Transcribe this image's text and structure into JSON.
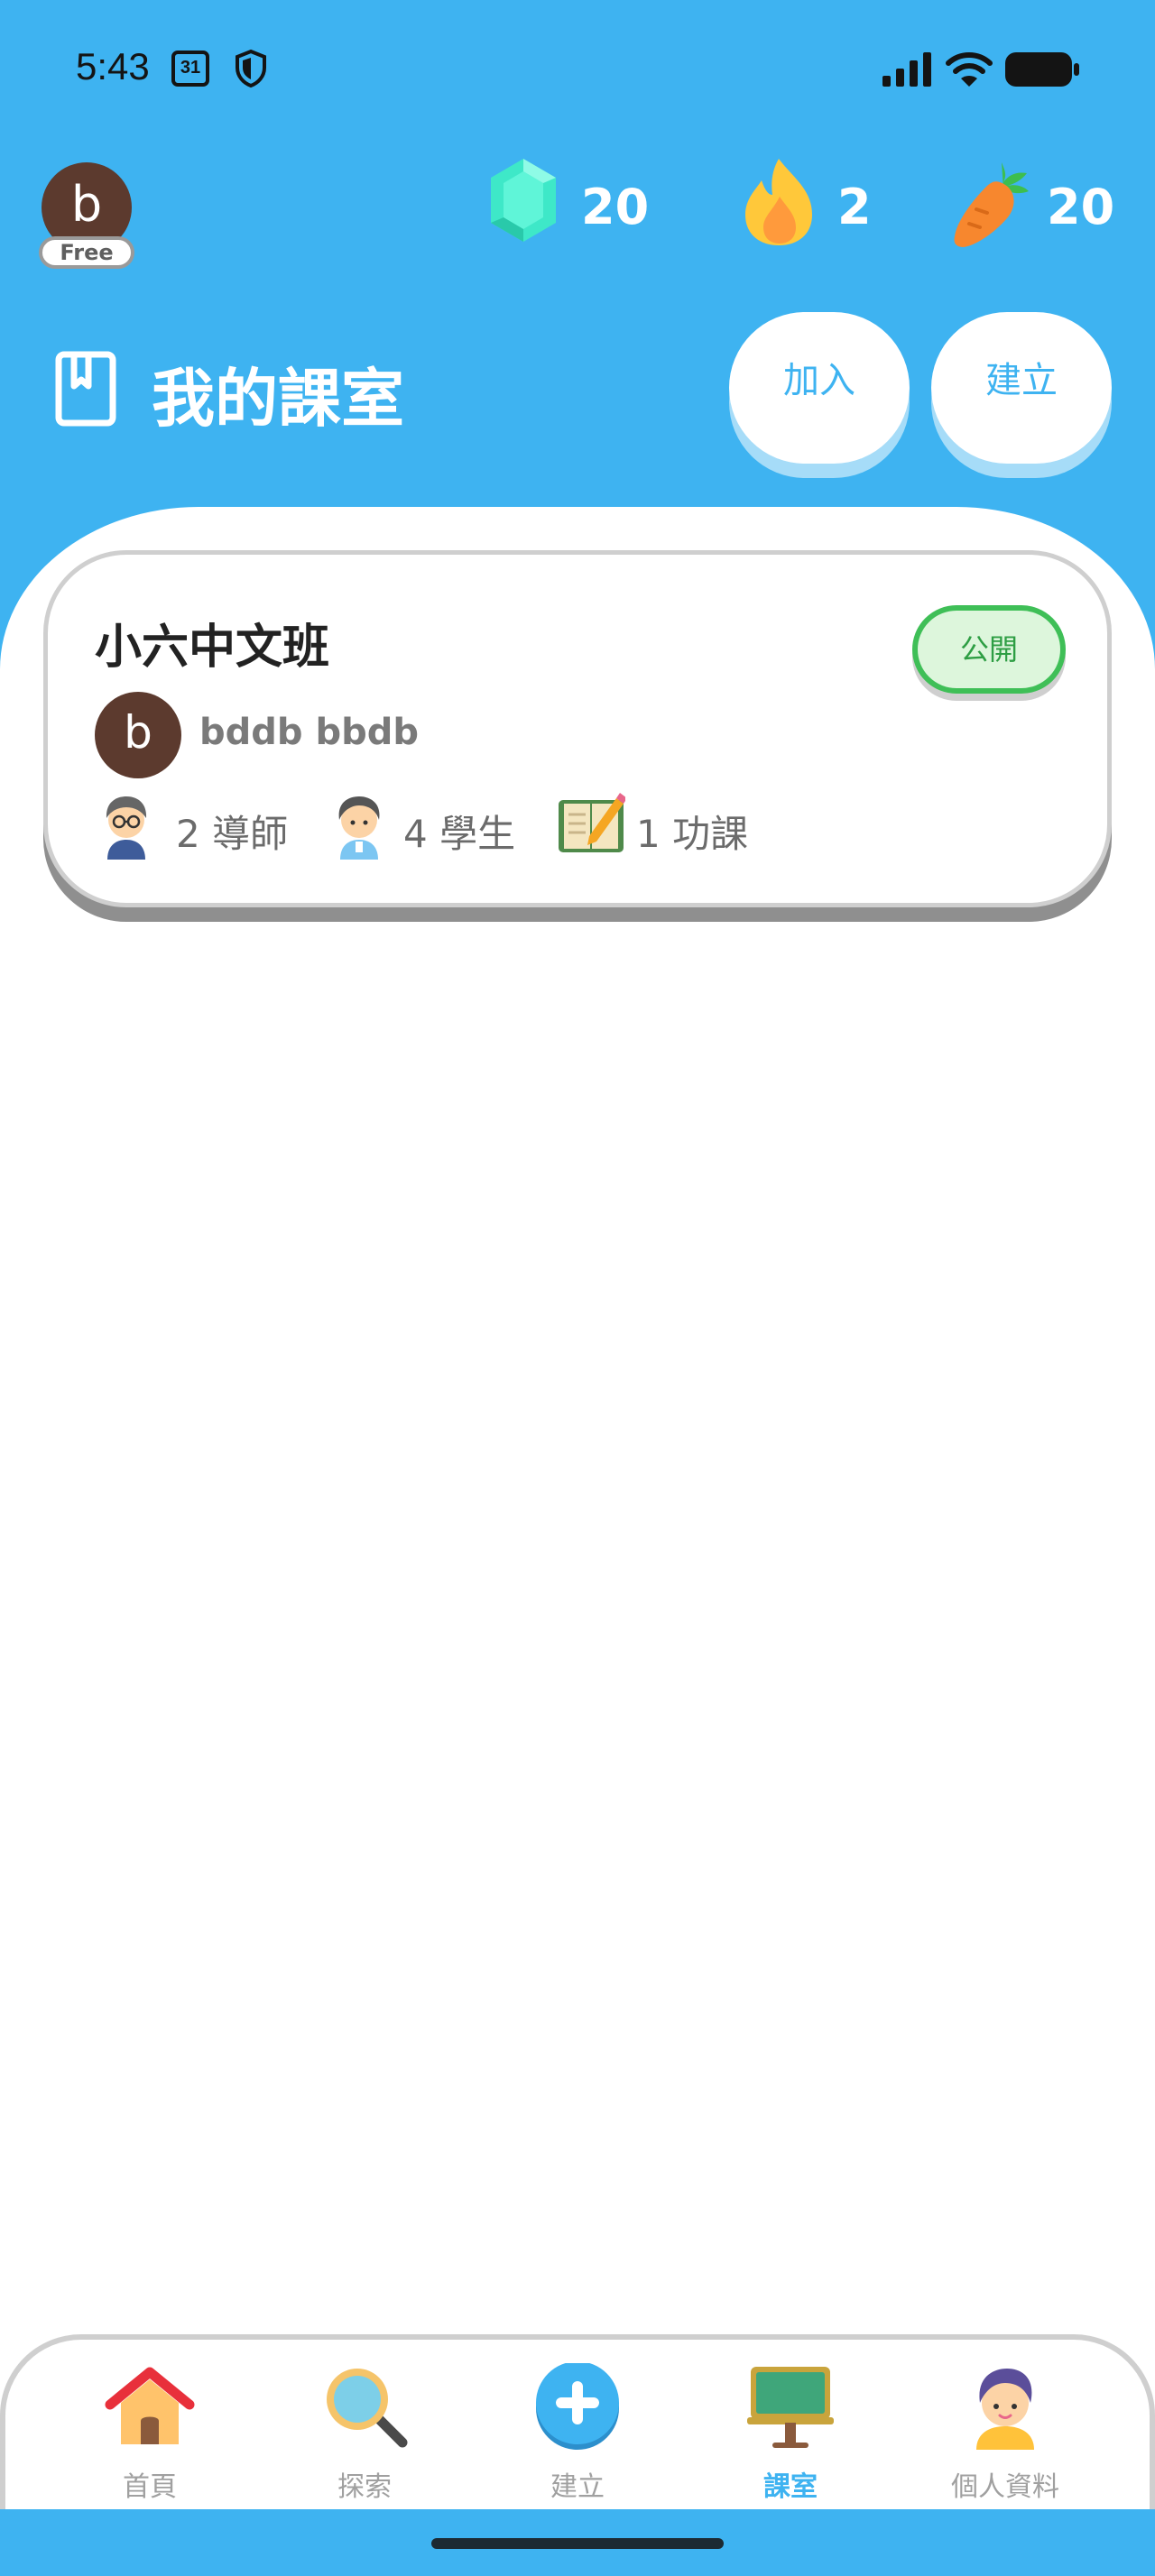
{
  "status_bar": {
    "time": "5:43",
    "calendar_day": "31"
  },
  "header": {
    "avatar_letter": "b",
    "plan_badge": "Free",
    "stats": [
      {
        "icon": "gem-icon",
        "value": "20"
      },
      {
        "icon": "flame-icon",
        "value": "2"
      },
      {
        "icon": "carrot-icon",
        "value": "20"
      }
    ],
    "title": "我的課室",
    "join_label": "加入",
    "create_label": "建立"
  },
  "classes": [
    {
      "name": "小六中文班",
      "visibility": "公開",
      "owner_avatar_letter": "b",
      "owner_name": "bddb bbdb",
      "teachers": "2 導師",
      "students": "4 學生",
      "homework": "1 功課"
    }
  ],
  "nav": {
    "items": [
      {
        "label": "首頁",
        "icon": "home-icon"
      },
      {
        "label": "探索",
        "icon": "magnifier-icon"
      },
      {
        "label": "建立",
        "icon": "plus-icon"
      },
      {
        "label": "課室",
        "icon": "classroom-icon",
        "active": true
      },
      {
        "label": "個人資料",
        "icon": "profile-icon"
      }
    ]
  },
  "colors": {
    "brand_blue": "#3EB3F1",
    "public_green": "#3FBF57"
  }
}
